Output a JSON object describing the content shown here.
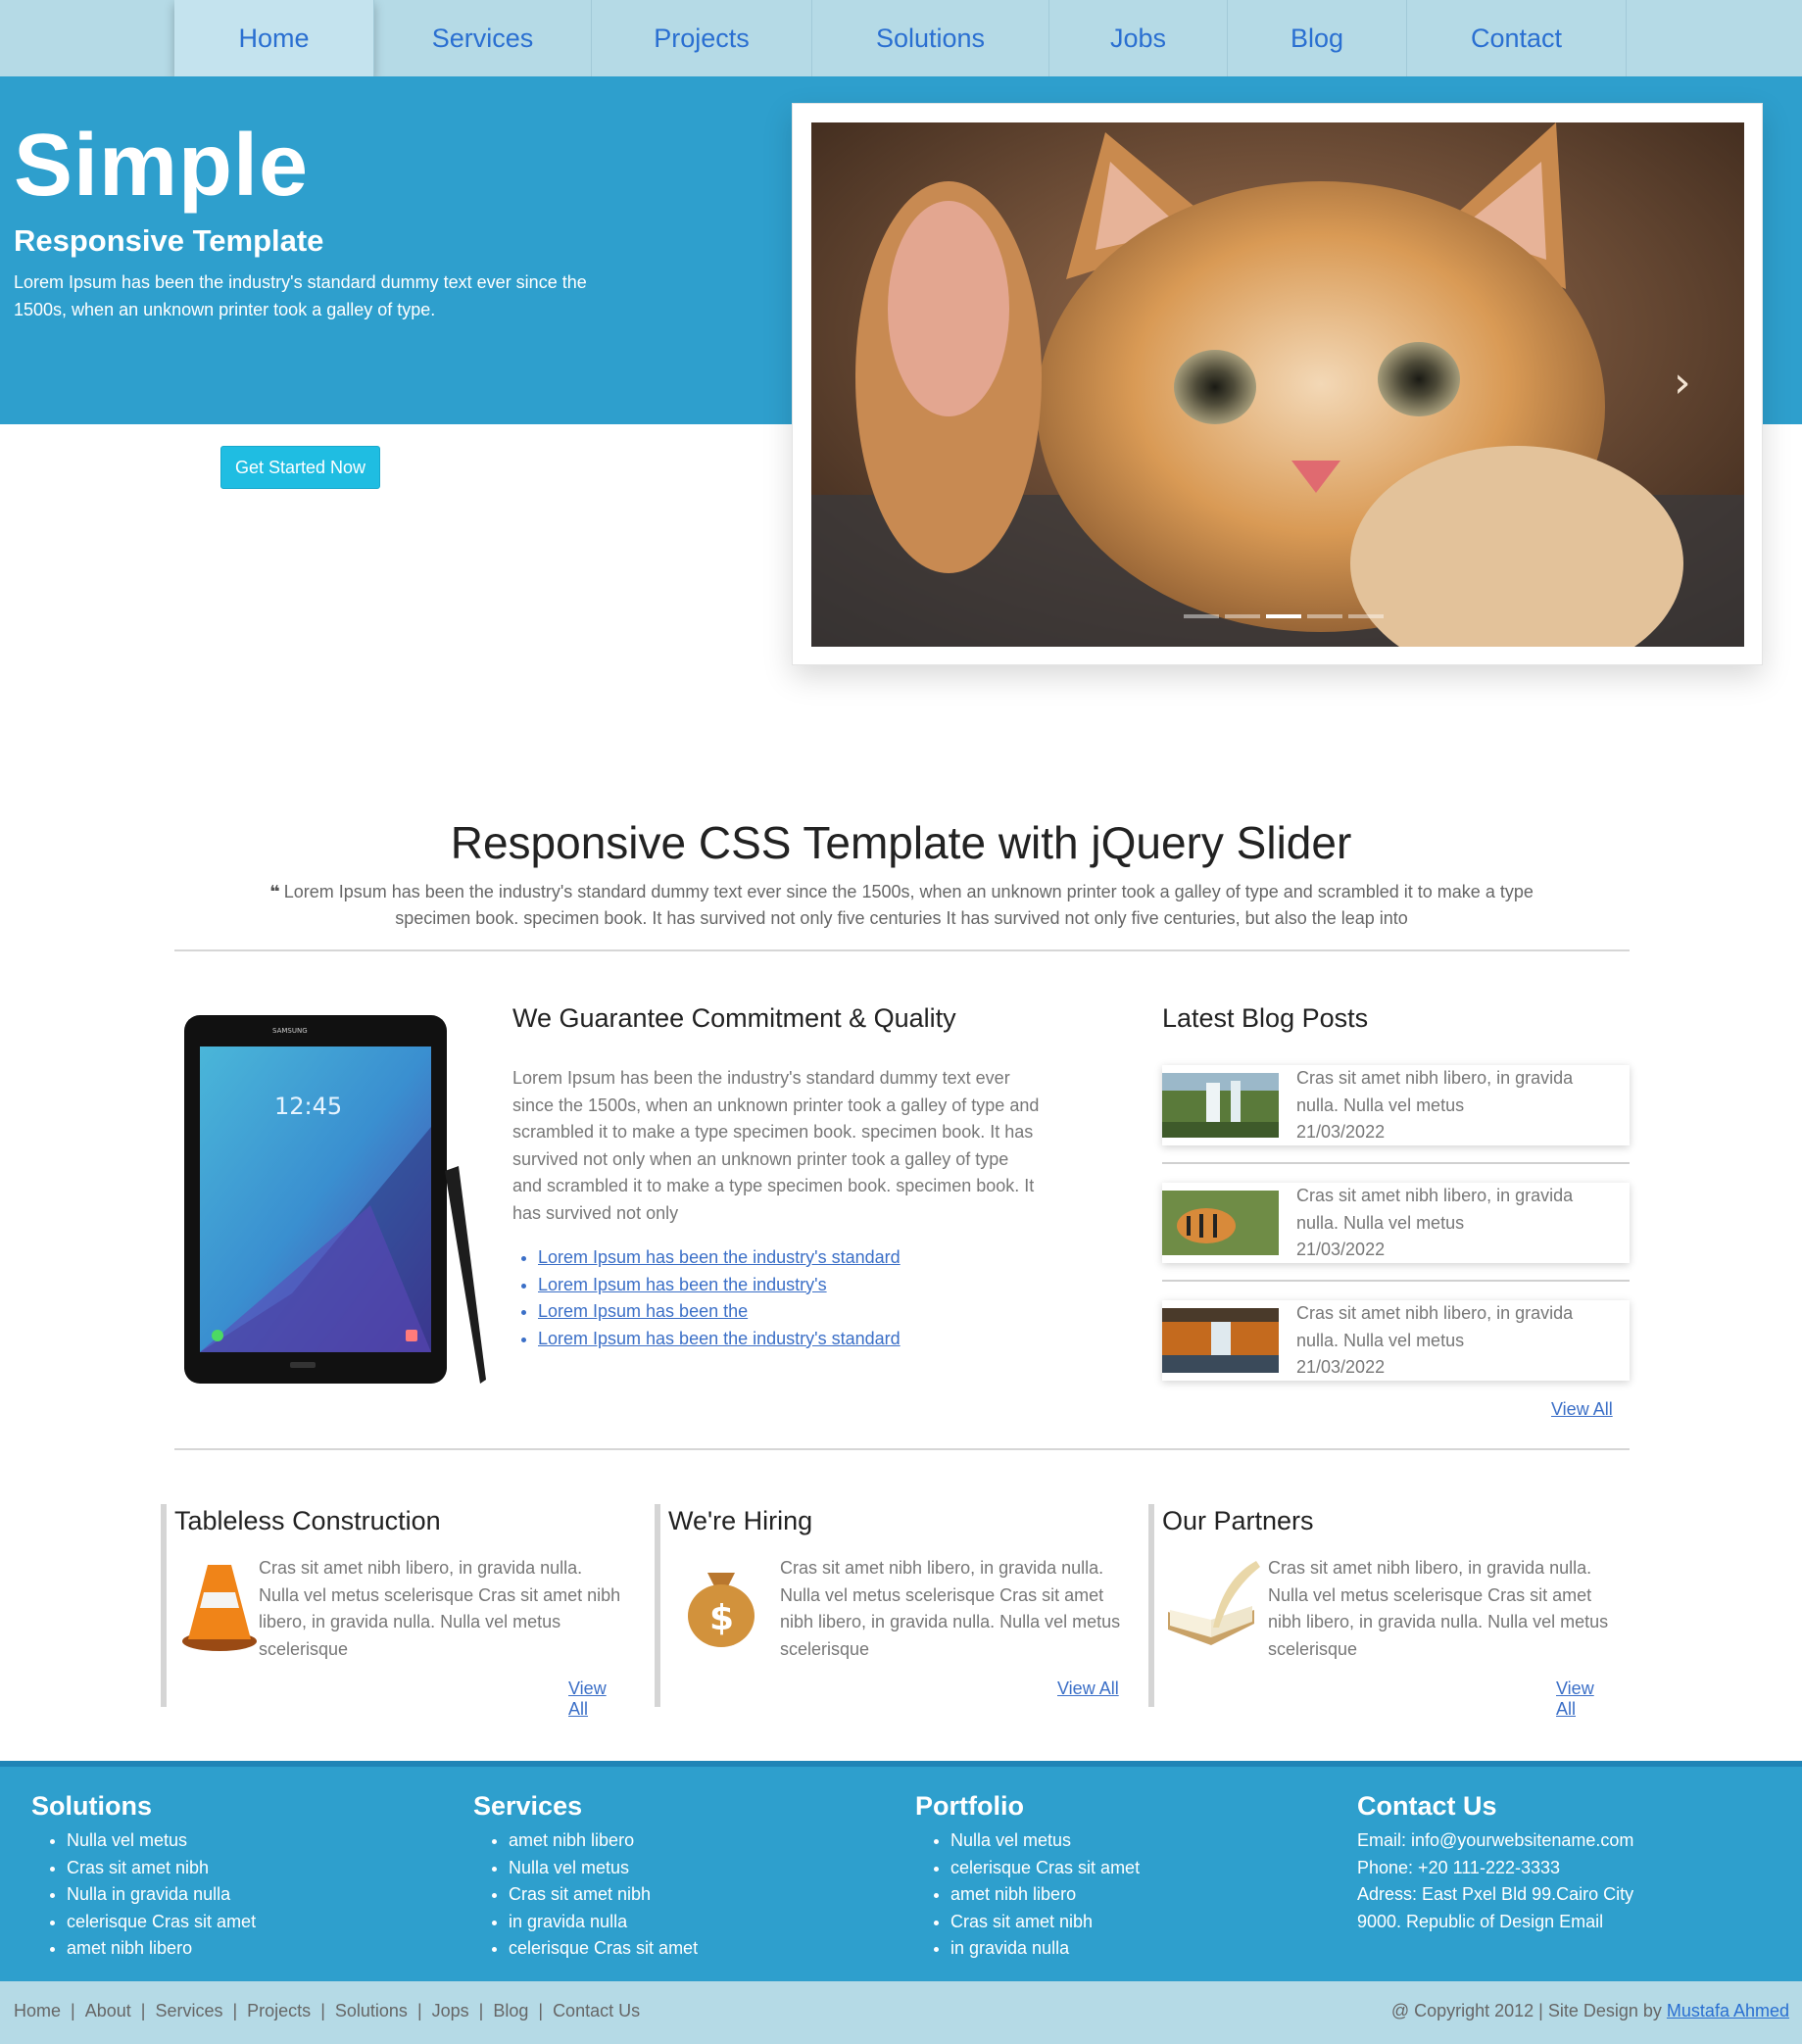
{
  "nav": {
    "items": [
      "Home",
      "Services",
      "Projects",
      "Solutions",
      "Jobs",
      "Blog",
      "Contact"
    ]
  },
  "hero": {
    "title": "Simple",
    "subtitle": "Responsive Template",
    "text": "Lorem Ipsum has been the industry's standard dummy text ever since the 1500s, when an unknown printer took a galley of type.",
    "cta": "Get Started Now",
    "slider_next_icon": "chevron-right-icon"
  },
  "intro": {
    "title": "Responsive CSS Template with jQuery Slider",
    "quote_icon": "quote-icon",
    "quote_mark": "❝",
    "text": "Lorem Ipsum has been the industry's standard dummy text ever since the 1500s, when an unknown printer took a galley of type and scrambled it to make a type specimen book. specimen book. It has survived not only five centuries It has survived not only five centuries, but also the leap into"
  },
  "guarantee": {
    "title": "We Guarantee Commitment & Quality",
    "text": "Lorem Ipsum has been the industry's standard dummy text ever since the 1500s, when an unknown printer took a galley of type and scrambled it to make a type specimen book. specimen book. It has survived not only when an unknown printer took a galley of type and scrambled it to make a type specimen book. specimen book. It has survived not only",
    "links": [
      "Lorem Ipsum has been the industry's standard",
      "Lorem Ipsum has been the industry's",
      "Lorem Ipsum has been the",
      "Lorem Ipsum has been the industry's standard"
    ],
    "tablet": {
      "brand": "SAMSUNG",
      "clock": "12:45"
    }
  },
  "blog": {
    "title": "Latest Blog Posts",
    "posts": [
      {
        "text": "Cras sit amet nibh libero, in gravida nulla. Nulla vel metus",
        "date": "21/03/2022"
      },
      {
        "text": "Cras sit amet nibh libero, in gravida nulla. Nulla vel metus",
        "date": "21/03/2022"
      },
      {
        "text": "Cras sit amet nibh libero, in gravida nulla. Nulla vel metus",
        "date": "21/03/2022"
      }
    ],
    "view_all": "View All"
  },
  "boxes": [
    {
      "title": "Tableless Construction",
      "text": "Cras sit amet nibh libero, in gravida nulla. Nulla vel metus scelerisque Cras sit amet nibh libero, in gravida nulla. Nulla vel metus scelerisque",
      "view_all": "View All",
      "icon": "traffic-cone-icon"
    },
    {
      "title": "We're Hiring",
      "text": "Cras sit amet nibh libero, in gravida nulla. Nulla vel metus scelerisque Cras sit amet nibh libero, in gravida nulla. Nulla vel metus scelerisque",
      "view_all": "View All",
      "icon": "money-bag-icon"
    },
    {
      "title": "Our Partners",
      "text": "Cras sit amet nibh libero, in gravida nulla. Nulla vel metus scelerisque Cras sit amet nibh libero, in gravida nulla. Nulla vel metus scelerisque",
      "view_all": "View All",
      "icon": "book-quill-icon"
    }
  ],
  "footer": {
    "solutions": {
      "title": "Solutions",
      "items": [
        "Nulla vel metus",
        "Cras sit amet nibh",
        "Nulla in gravida nulla",
        "celerisque Cras sit amet",
        "amet nibh libero"
      ]
    },
    "services": {
      "title": "Services",
      "items": [
        "amet nibh libero",
        "Nulla vel metus",
        "Cras sit amet nibh",
        "in gravida nulla",
        "celerisque Cras sit amet"
      ]
    },
    "portfolio": {
      "title": "Portfolio",
      "items": [
        "Nulla vel metus",
        "celerisque Cras sit amet",
        "amet nibh libero",
        "Cras sit amet nibh",
        "in gravida nulla"
      ]
    },
    "contact": {
      "title": "Contact Us",
      "lines": [
        "Email: info@yourwebsitename.com",
        "Phone: +20 111-222-3333",
        "Adress: East Pxel Bld 99.Cairo City",
        "9000. Republic of Design Email"
      ]
    }
  },
  "bottom": {
    "links": [
      "Home",
      "About",
      "Services",
      "Projects",
      "Solutions",
      "Jops",
      "Blog",
      "Contact Us"
    ],
    "separator": "|",
    "copyright": "@ Copyright 2012 | Site Design by ",
    "author": "Mustafa Ahmed"
  },
  "colors": {
    "nav_bg": "#b5dae6",
    "hero_bg": "#2e9fcd",
    "cta": "#1fbde2",
    "link": "#3b6fc7"
  }
}
